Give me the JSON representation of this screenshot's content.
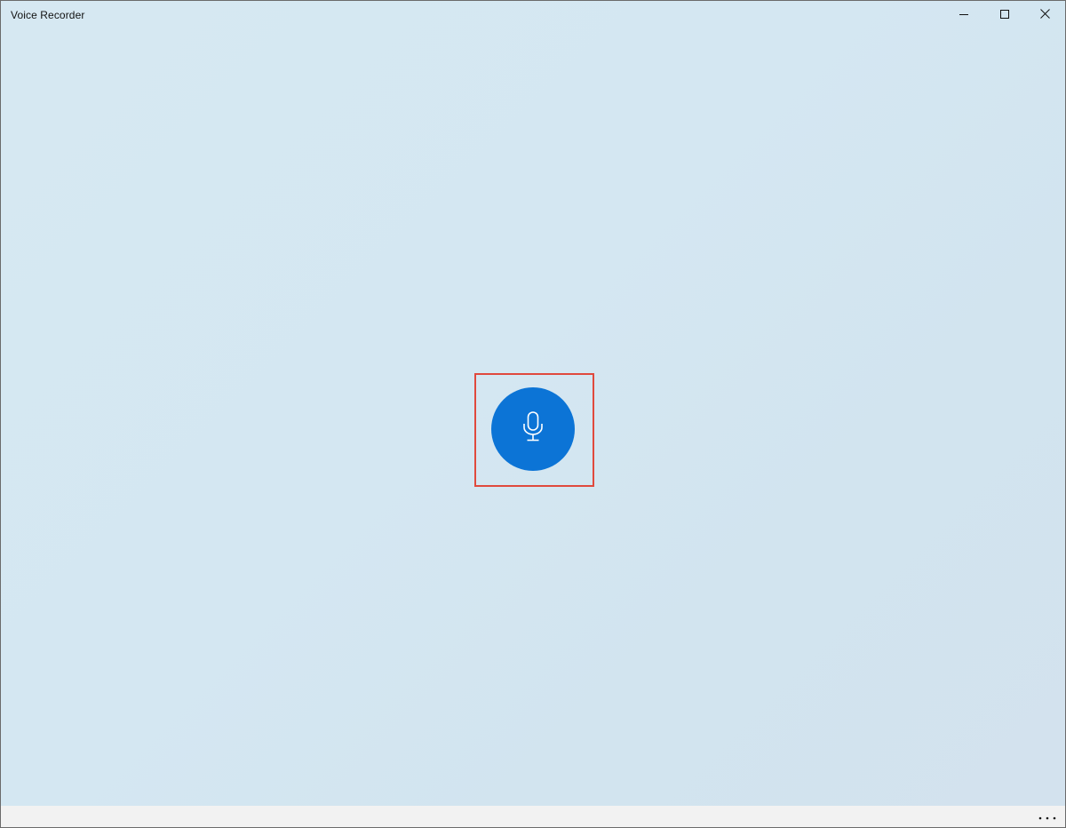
{
  "window": {
    "title": "Voice Recorder"
  },
  "caption_buttons": {
    "minimize_icon": "minimize-icon",
    "maximize_icon": "maximize-icon",
    "close_icon": "close-icon"
  },
  "main": {
    "record_icon": "microphone-icon",
    "record_color": "#0c74d6",
    "highlight_color": "#e0493d"
  },
  "bottom_bar": {
    "more_icon": "more-icon"
  }
}
